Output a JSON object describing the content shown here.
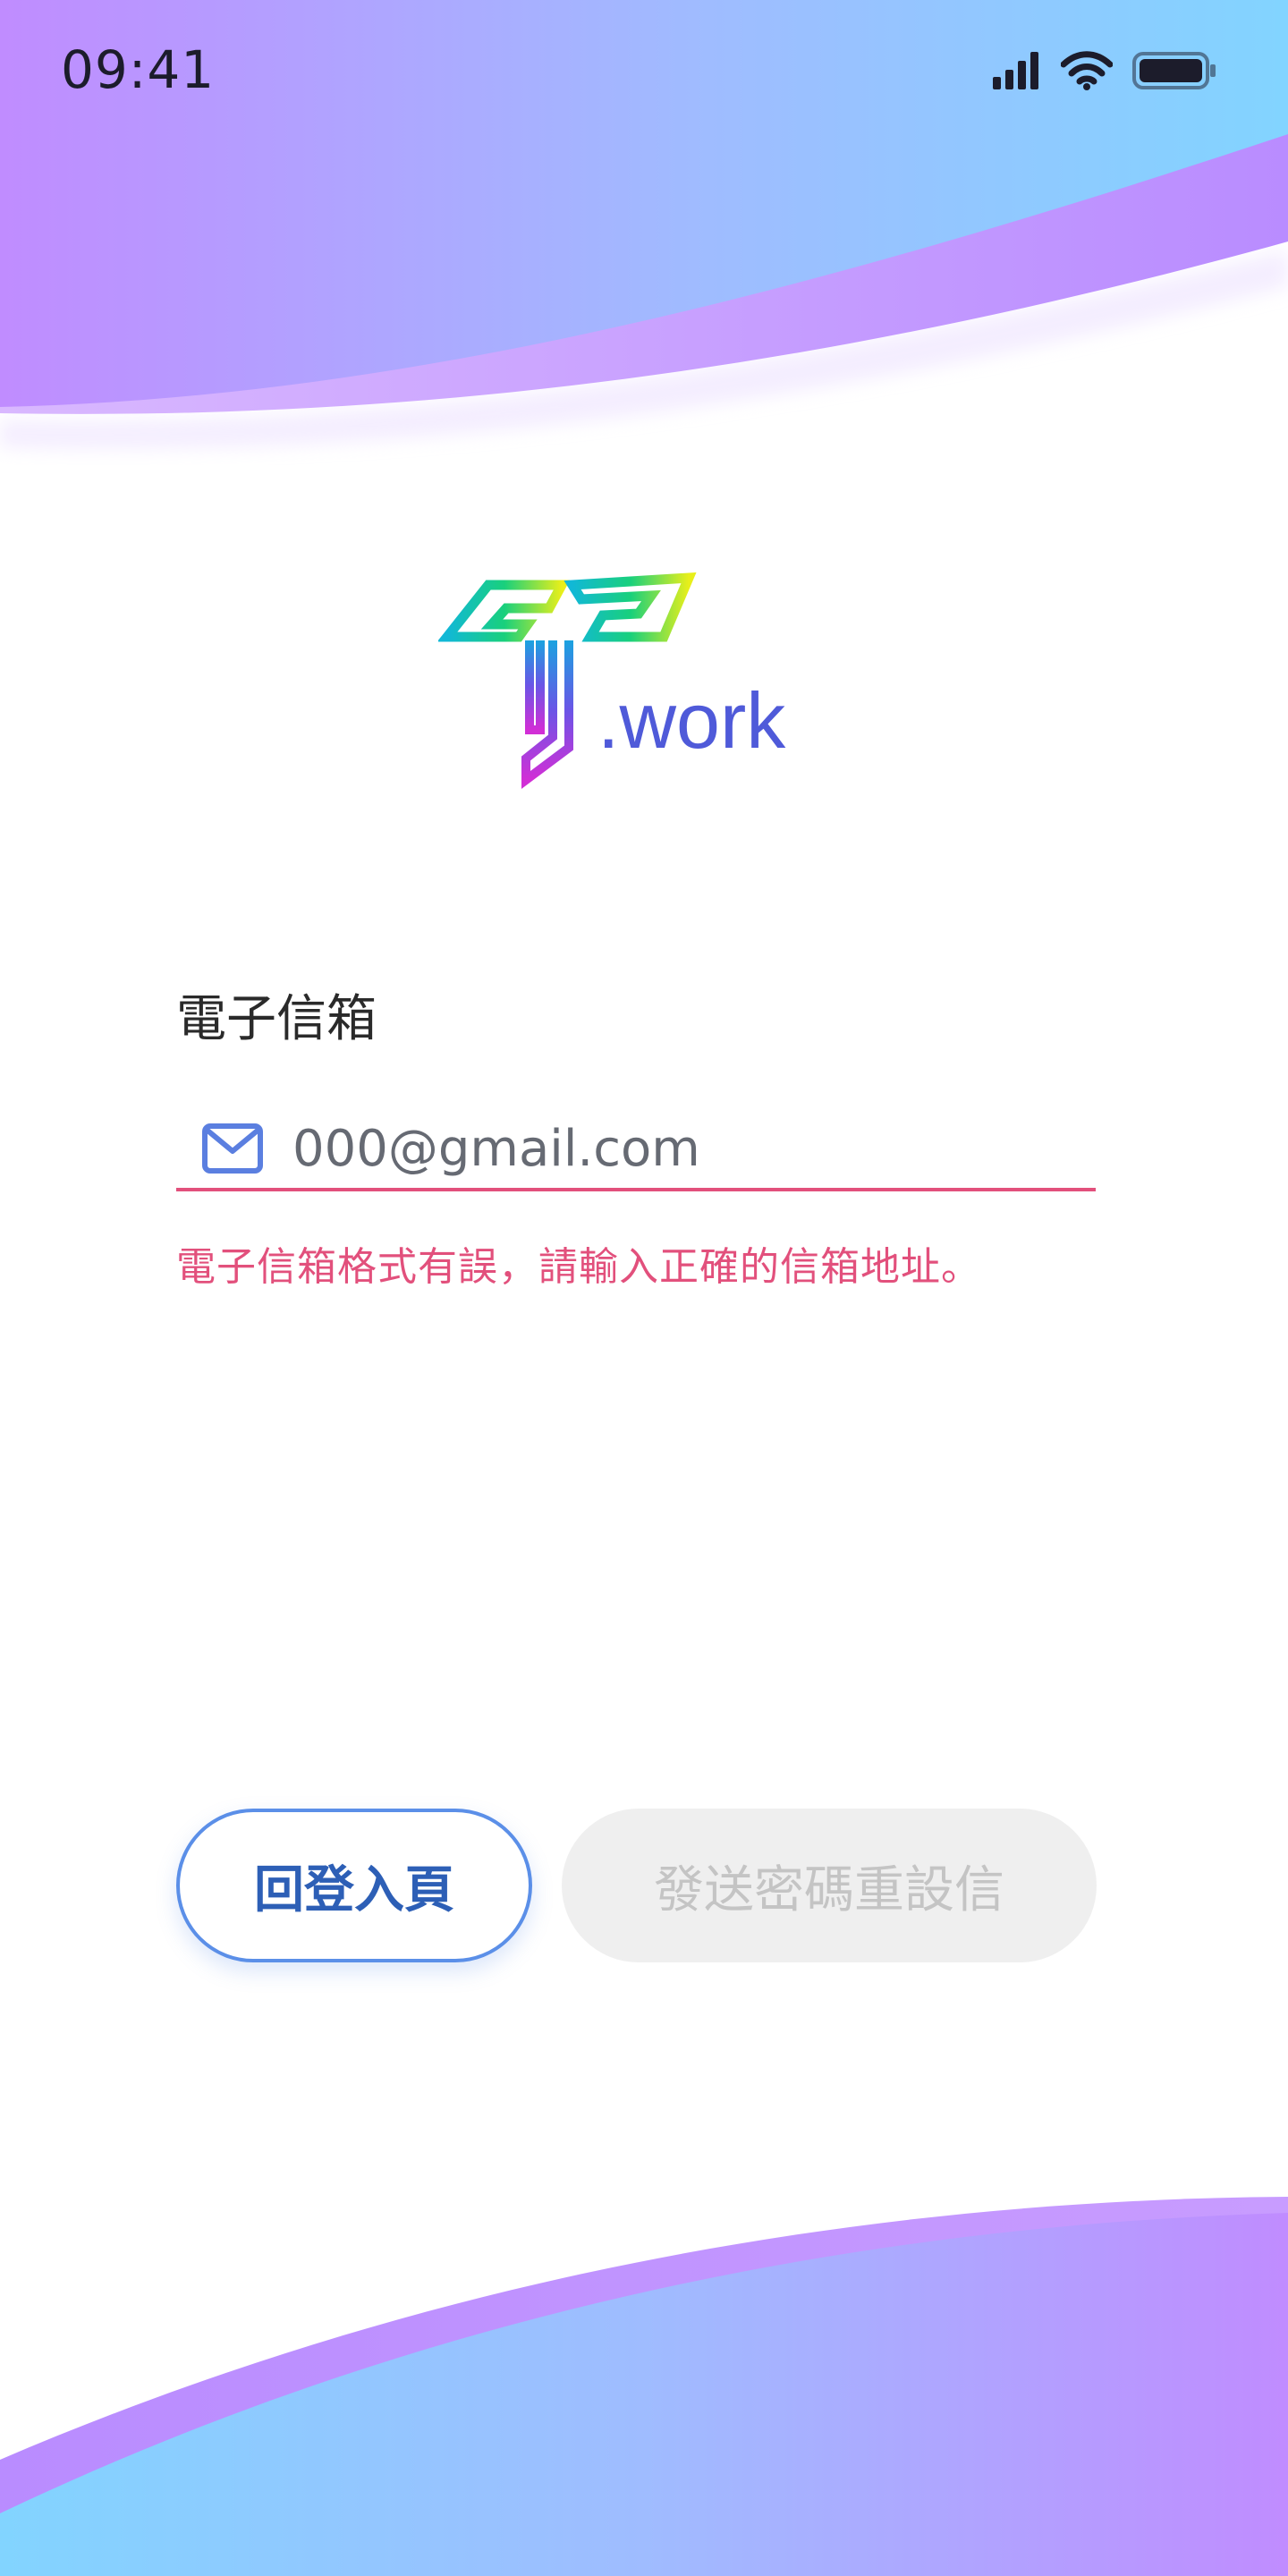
{
  "status_bar": {
    "time": "09:41",
    "icons": [
      "signal-icon",
      "wifi-icon",
      "battery-icon"
    ]
  },
  "brand": {
    "logo_text": ".work",
    "colors": {
      "purple": "#bf8cff",
      "sky": "#82d4ff",
      "accent_pink": "#e2507c",
      "button_blue": "#5b8fe8"
    }
  },
  "form": {
    "email_label": "電子信箱",
    "email_value": "000@gmail.com",
    "email_icon": "mail-icon",
    "error_message": "電子信箱格式有誤，請輸入正確的信箱地址。"
  },
  "buttons": {
    "back_label": "回登入頁",
    "send_label": "發送密碼重設信"
  }
}
